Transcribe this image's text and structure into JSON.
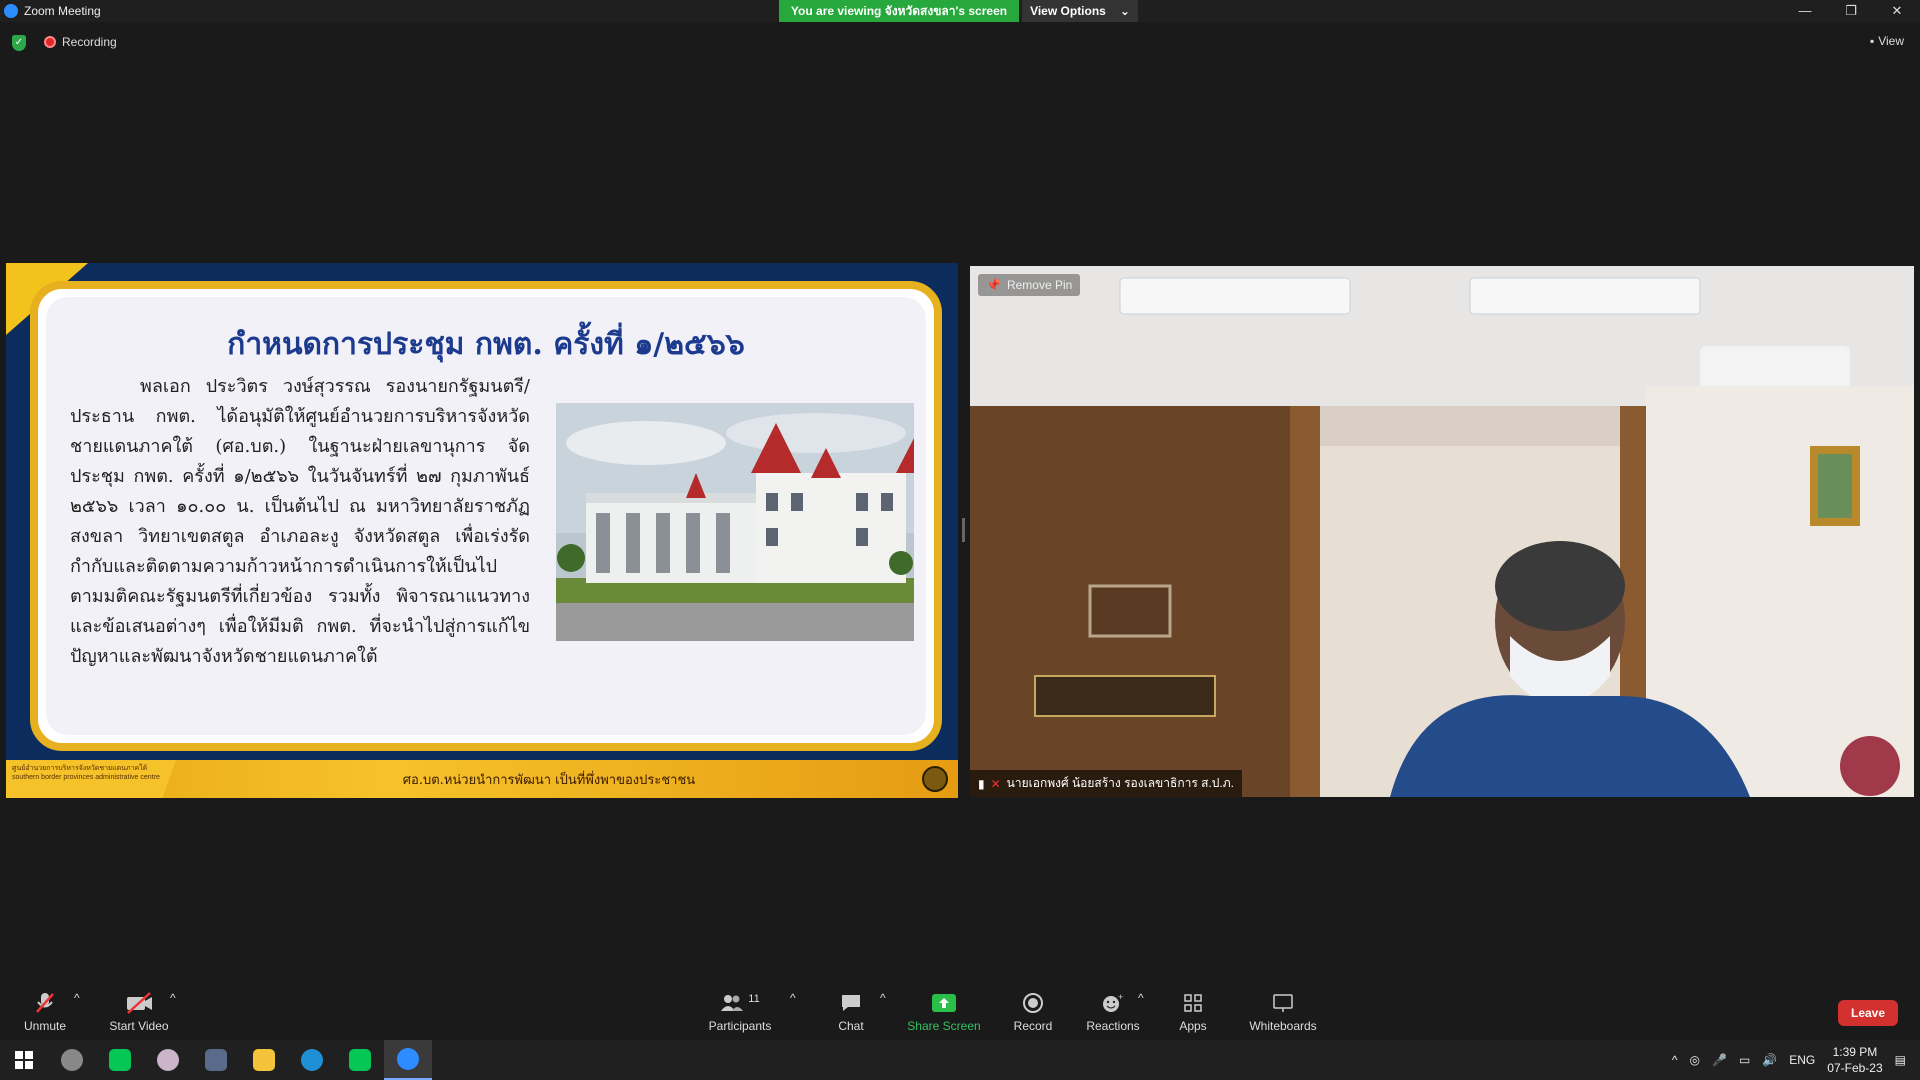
{
  "window": {
    "title": "Zoom Meeting"
  },
  "banner": {
    "viewing": "You are viewing จังหวัดสงขลา's screen",
    "view_options": "View Options"
  },
  "window_controls": {
    "minimize": "—",
    "restore": "❐",
    "close": "✕"
  },
  "status": {
    "recording": "Recording",
    "view": "View"
  },
  "slide": {
    "title": "กำหนดการประชุม กพต. ครั้งที่ ๑/๒๕๖๖",
    "body": "พลเอก ประวิตร วงษ์สุวรรณ รองนายกรัฐมนตรี/ประธาน กพต. ได้อนุมัติให้ศูนย์อำนวยการบริหารจังหวัดชายแดนภาคใต้ (ศอ.บต.) ในฐานะฝ่ายเลขานุการ จัดประชุม กพต. ครั้งที่ ๑/๒๕๖๖ ในวันจันทร์ที่ ๒๗ กุมภาพันธ์ ๒๕๖๖ เวลา ๑๐.๐๐ น. เป็นต้นไป ณ มหาวิทยาลัยราชภัฏสงขลา วิทยาเขตสตูล อำเภอละงู จังหวัดสตูล เพื่อเร่งรัด กำกับและติดตามความก้าวหน้าการดำเนินการให้เป็นไปตามมติคณะรัฐมนตรีที่เกี่ยวข้อง รวมทั้ง พิจารณาแนวทางและข้อเสนอต่างๆ เพื่อให้มีมติ กพต. ที่จะนำไปสู่การแก้ไขปัญหาและพัฒนาจังหวัดชายแดนภาคใต้",
    "footer_left": "ศูนย์อำนวยการบริหารจังหวัดชายแดนภาคใต้ southern border provinces administrative centre",
    "footer_center": "ศอ.บต.หน่วยนำการพัฒนา เป็นที่พึ่งพาของประชาชน"
  },
  "video": {
    "remove_pin": "Remove Pin",
    "participant_name": "นายเอกพงศ์ น้อยสร้าง รองเลขาธิการ ส.ป.ภ."
  },
  "toolbar": {
    "unmute": "Unmute",
    "start_video": "Start Video",
    "participants": "Participants",
    "participants_count": "11",
    "chat": "Chat",
    "share_screen": "Share Screen",
    "record": "Record",
    "reactions": "Reactions",
    "apps": "Apps",
    "whiteboards": "Whiteboards",
    "leave": "Leave"
  },
  "taskbar": {
    "language": "ENG",
    "time": "1:39 PM",
    "date": "07-Feb-23"
  },
  "colors": {
    "share_green": "#26a83c",
    "leave_red": "#d3312f",
    "slide_title": "#1c3b8e"
  }
}
